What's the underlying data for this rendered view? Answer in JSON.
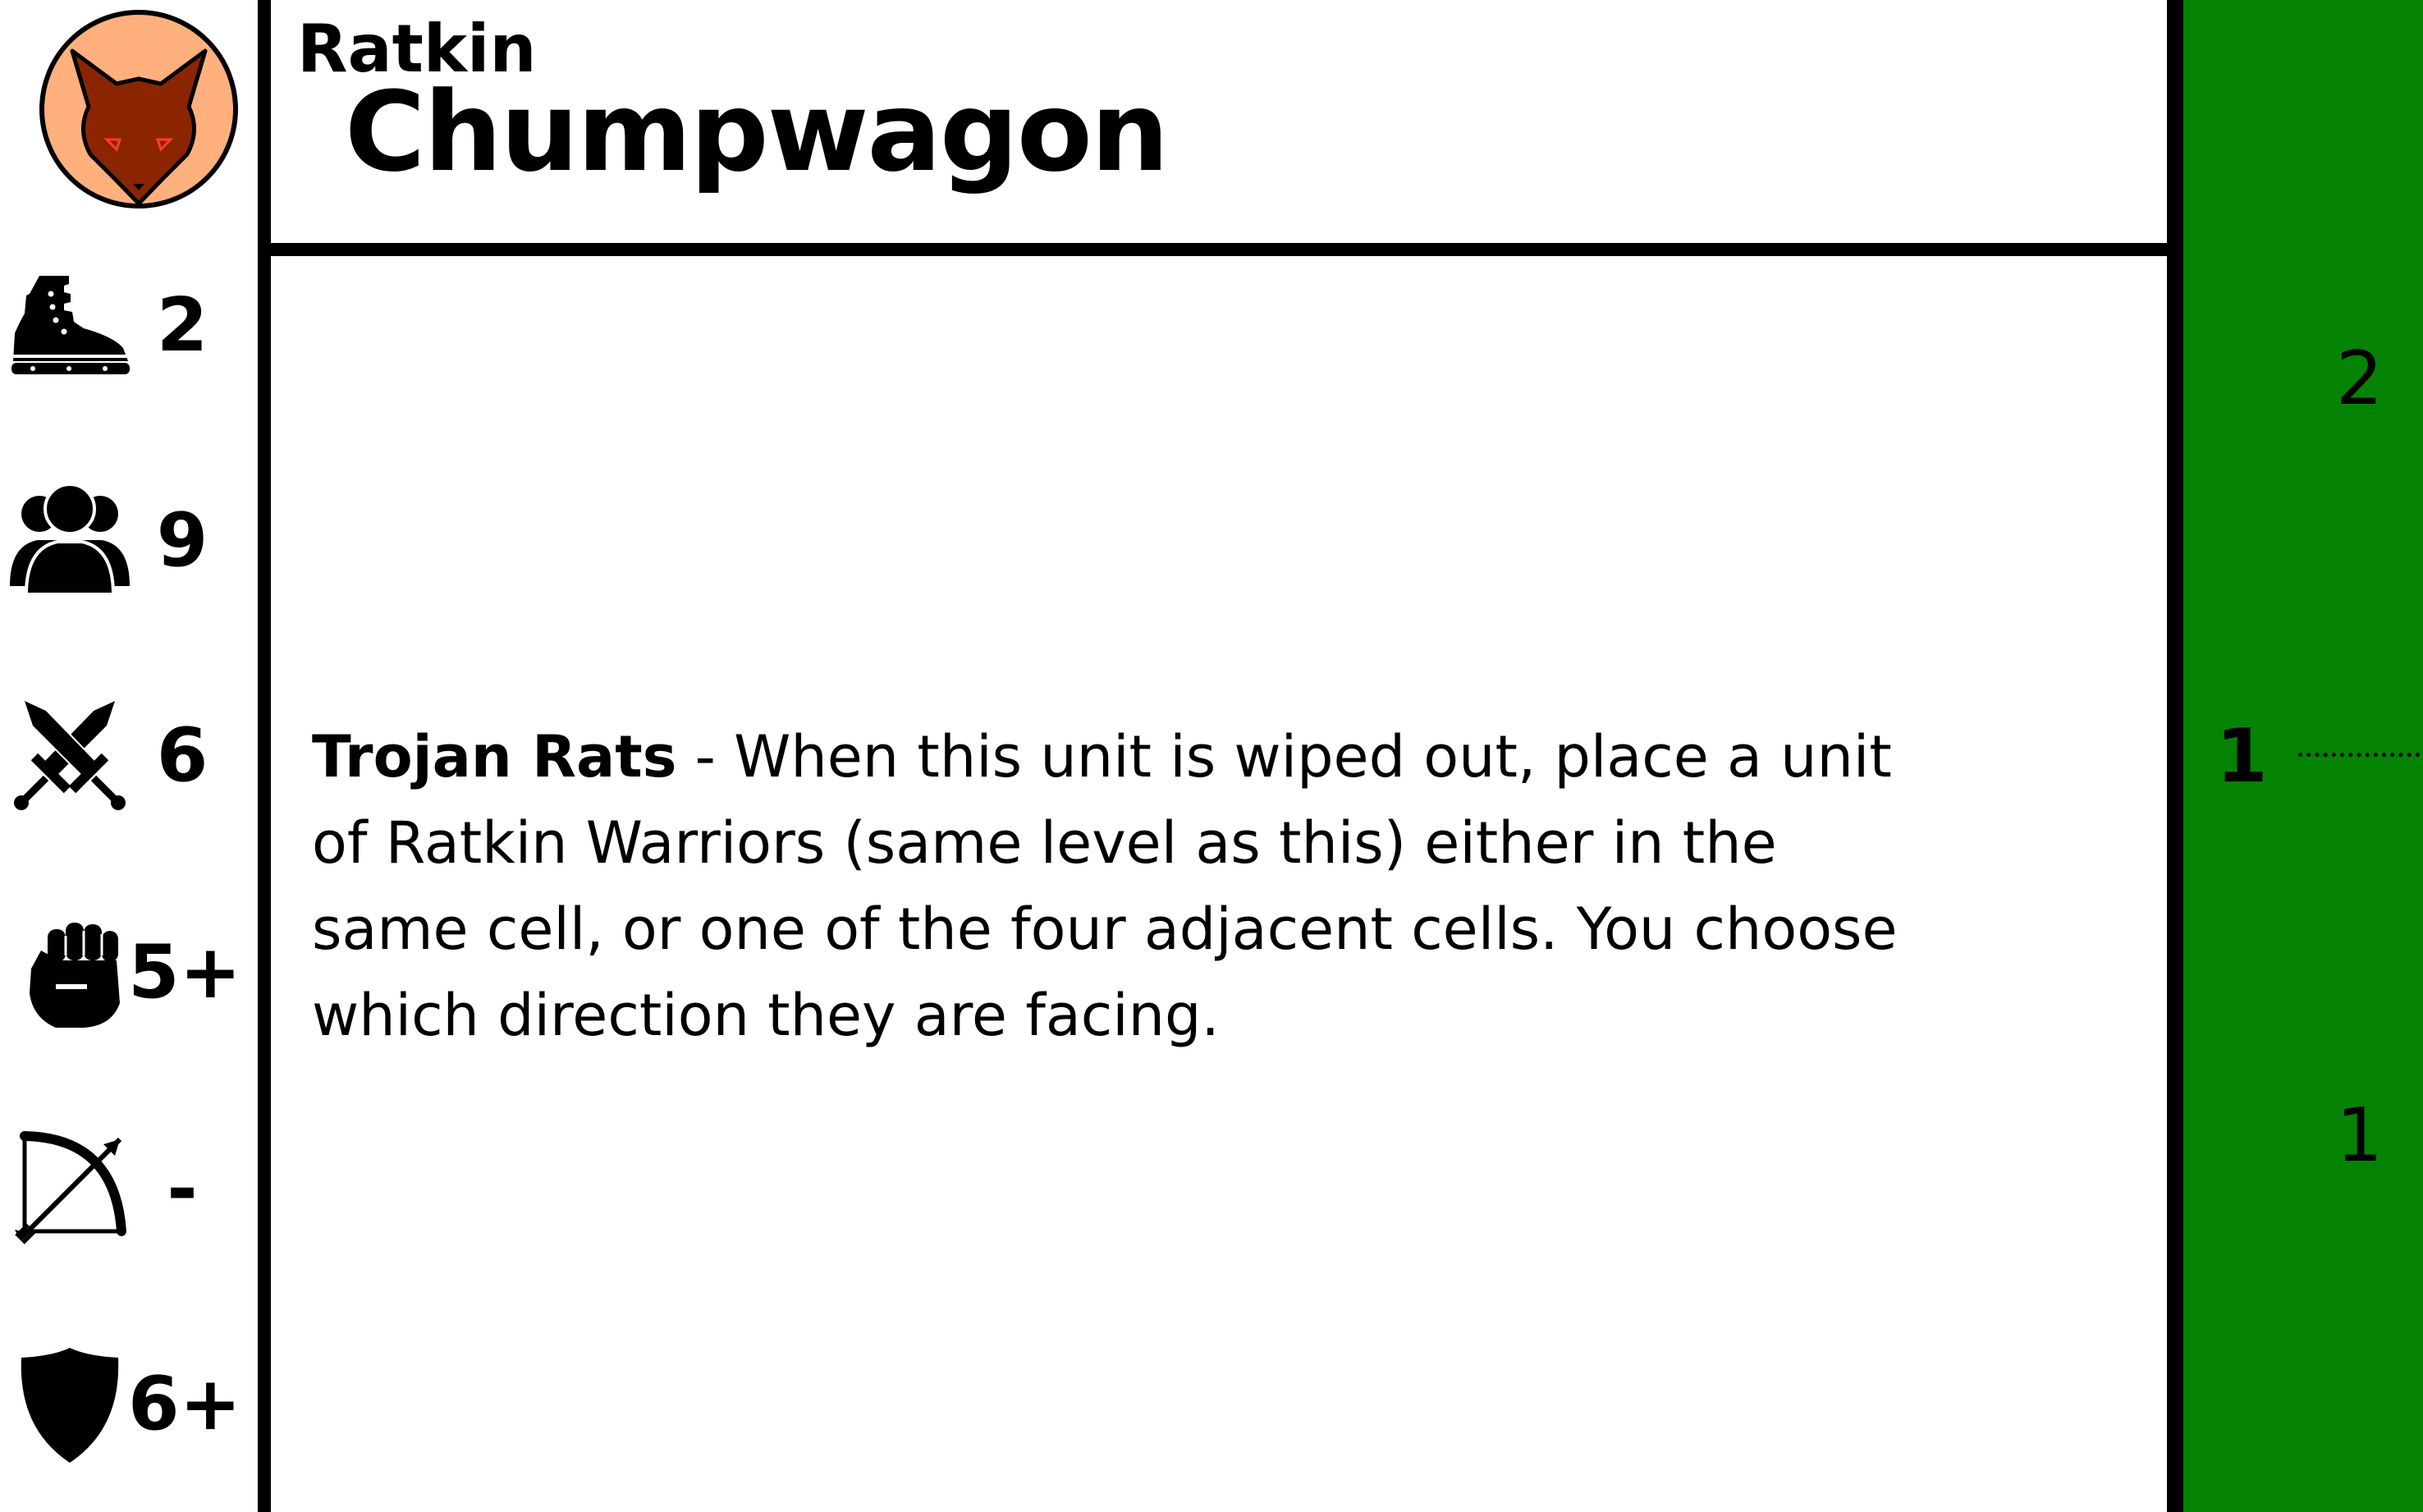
{
  "card": {
    "race": "Ratkin",
    "unit_name": "Chumpwagon",
    "faction_icon": "rat-head-icon",
    "colors": {
      "badge_fill": "#FFB07C",
      "rat_fill": "#8B2500",
      "track_green": "#048304",
      "border": "#000000"
    }
  },
  "stats": [
    {
      "icon": "boot-icon",
      "value": "2"
    },
    {
      "icon": "group-icon",
      "value": "9"
    },
    {
      "icon": "crossed-swords-icon",
      "value": "6"
    },
    {
      "icon": "fist-icon",
      "value": "5+"
    },
    {
      "icon": "bow-icon",
      "value": "-"
    },
    {
      "icon": "shield-icon",
      "value": "6+"
    }
  ],
  "ability": {
    "name": "Trojan Rats",
    "separator": " - ",
    "text": "When this unit is wiped out, place a unit of Ratkin Warriors (same level as this) either in the same cell, or one of the four adjacent cells. You choose which direction they are facing."
  },
  "track": {
    "top_value": "2",
    "current_value": "1",
    "bottom_value": "1"
  }
}
